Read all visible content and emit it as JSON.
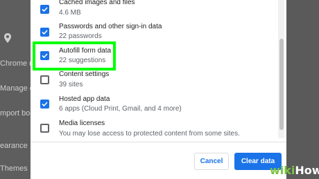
{
  "background": {
    "rows": [
      "Chrome na",
      "Manage ot",
      "mport boo",
      "earance",
      "Themes"
    ]
  },
  "dialog": {
    "items": [
      {
        "title": "Cached images and files",
        "subtitle": "4.6 MB",
        "checked": true
      },
      {
        "title": "Passwords and other sign-in data",
        "subtitle": "22 passwords",
        "checked": true
      },
      {
        "title": "Autofill form data",
        "subtitle": "22 suggestions",
        "checked": true
      },
      {
        "title": "Content settings",
        "subtitle": "39 sites",
        "checked": false
      },
      {
        "title": "Hosted app data",
        "subtitle": "6 apps (Cloud Print, Gmail, and 4 more)",
        "checked": true
      },
      {
        "title": "Media licenses",
        "subtitle": "You may lose access to protected content from some sites.",
        "checked": false
      }
    ],
    "cancel_label": "Cancel",
    "clear_label": "Clear data"
  },
  "colors": {
    "accent": "#1a73e8",
    "highlight": "#00ff00"
  },
  "watermark": {
    "brand_a": "wiki",
    "brand_b": "How"
  }
}
